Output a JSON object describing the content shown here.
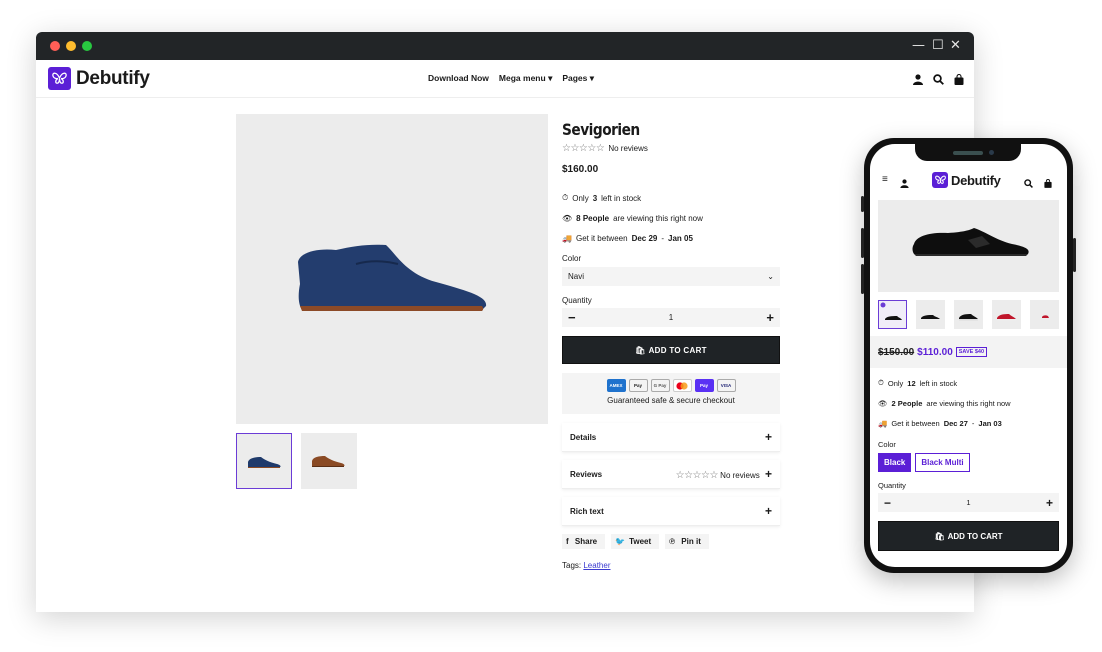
{
  "brand": {
    "name": "Debutify",
    "accent": "#5b1fd6"
  },
  "desktop": {
    "nav": [
      {
        "label": "Download Now"
      },
      {
        "label": "Mega menu"
      },
      {
        "label": "Pages"
      }
    ],
    "window_controls": {
      "minimize": "—",
      "maximize": "☐",
      "close": "✕"
    },
    "product": {
      "title": "Sevigorien",
      "rating_stars": "☆☆☆☆☆",
      "reviews_text": "No reviews",
      "price": "$160.00",
      "stock": {
        "pre": "Only",
        "count": "3",
        "post": "left in stock"
      },
      "viewing": {
        "count": "8 People",
        "post": "are viewing this right now"
      },
      "delivery": {
        "pre": "Get it between",
        "from": "Dec 29",
        "sep": "-",
        "to": "Jan 05"
      },
      "color_label": "Color",
      "color_value": "Navi",
      "quantity_label": "Quantity",
      "quantity_value": "1",
      "add_to_cart": "ADD TO CART",
      "payment_methods": [
        "AMEX",
        "Pay",
        "G Pay",
        "MC",
        "Pay",
        "VISA"
      ],
      "secure_text": "Guaranteed safe & secure checkout",
      "accordions": [
        {
          "label": "Details",
          "extra": ""
        },
        {
          "label": "Reviews",
          "extra": "No reviews"
        },
        {
          "label": "Rich text",
          "extra": ""
        }
      ],
      "share": [
        {
          "label": "Share"
        },
        {
          "label": "Tweet"
        },
        {
          "label": "Pin it"
        }
      ],
      "tags_label": "Tags:",
      "tag": "Leather",
      "shoe_color": "#1f3a6b",
      "thumb_colors": [
        "#1f3a6b",
        "#8a4a24"
      ]
    }
  },
  "mobile": {
    "old_price": "$150.00",
    "price": "$110.00",
    "save_badge": "SAVE $40",
    "stock": {
      "pre": "Only",
      "count": "12",
      "post": "left in stock"
    },
    "viewing": {
      "count": "2 People",
      "post": "are viewing this right now"
    },
    "delivery": {
      "pre": "Get it between",
      "from": "Dec 27",
      "sep": "-",
      "to": "Jan 03"
    },
    "color_label": "Color",
    "color_options": [
      "Black",
      "Black Multi"
    ],
    "quantity_label": "Quantity",
    "quantity_value": "1",
    "add_to_cart": "ADD TO CART",
    "thumb_colors": [
      "#111111",
      "#111111",
      "#111111",
      "#c0162b",
      "#c0162b"
    ]
  }
}
